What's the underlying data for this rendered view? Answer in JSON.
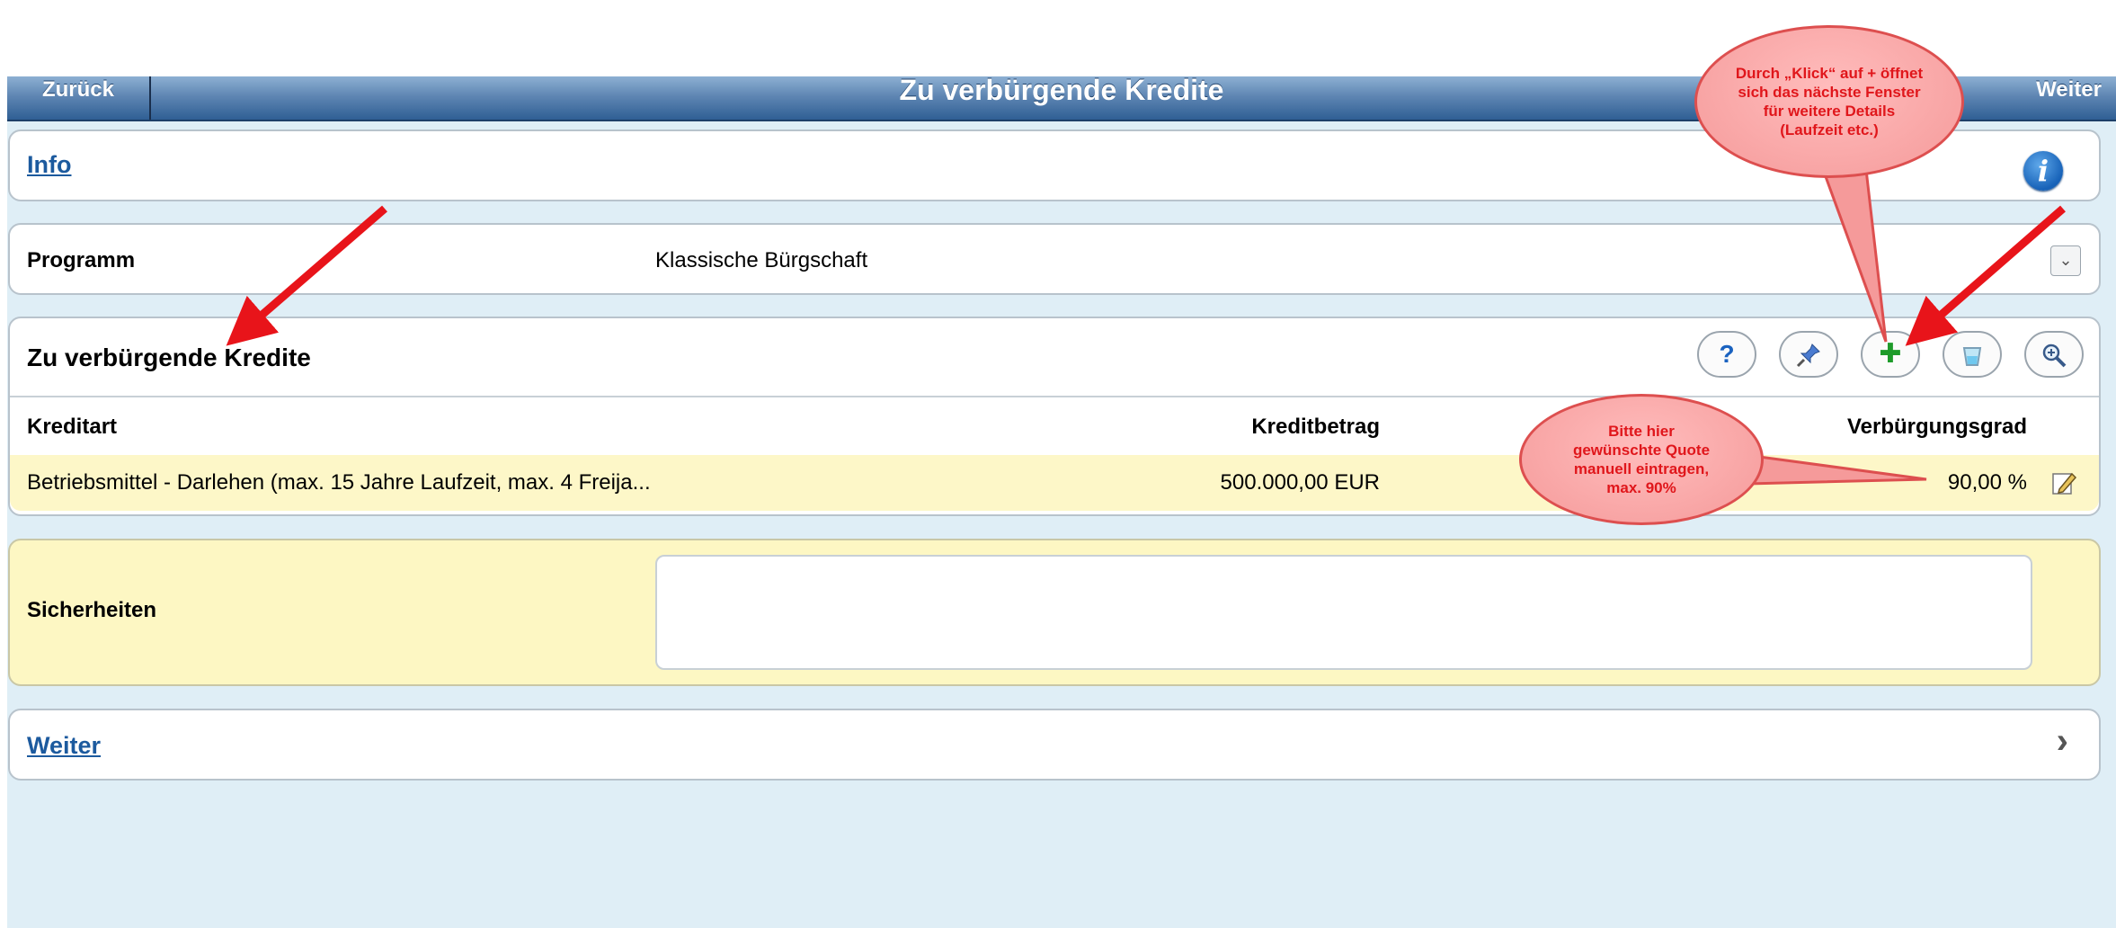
{
  "titlebar": {
    "back_label": "Zurück",
    "title": "Zu verbürgende Kredite",
    "next_label": "Weiter"
  },
  "info": {
    "label": "Info",
    "icon": "info-icon"
  },
  "programm": {
    "label": "Programm",
    "value": "Klassische Bürgschaft",
    "dropdown_icon": "chevron-down-icon"
  },
  "credits": {
    "section_title": "Zu verbürgende Kredite",
    "toolbar": {
      "help_icon": "question-mark-icon",
      "help_glyph": "?",
      "pin_icon": "pin-icon",
      "add_icon": "plus-icon",
      "add_glyph": "✚",
      "delete_icon": "trash-icon",
      "zoom_icon": "magnifier-icon"
    },
    "columns": [
      "Kreditart",
      "Kreditbetrag",
      "Verbürgungsgrad"
    ],
    "rows": [
      {
        "kreditart": "Betriebsmittel - Darlehen (max. 15 Jahre Laufzeit, max. 4 Freija...",
        "kreditbetrag": "500.000,00 EUR",
        "verbuergungsgrad": "90,00 %"
      }
    ]
  },
  "sicherheiten": {
    "label": "Sicherheiten",
    "value": ""
  },
  "weiter": {
    "label": "Weiter",
    "chevron": "›"
  },
  "callouts": {
    "plus_hint": "Durch „Klick“ auf + öffnet sich das nächste Fenster für weitere Details (Laufzeit etc.)",
    "quote_hint": "Bitte hier gewünschte Quote manuell eintragen, max. 90%"
  },
  "colors": {
    "titlebar": "#2f5f94",
    "link": "#1c5a9e",
    "row_highlight": "#fdf7c8",
    "callout_fill": "#f59a9a",
    "callout_text": "#e0161b",
    "arrow": "#e8141a",
    "add_green": "#1e9b2a"
  }
}
